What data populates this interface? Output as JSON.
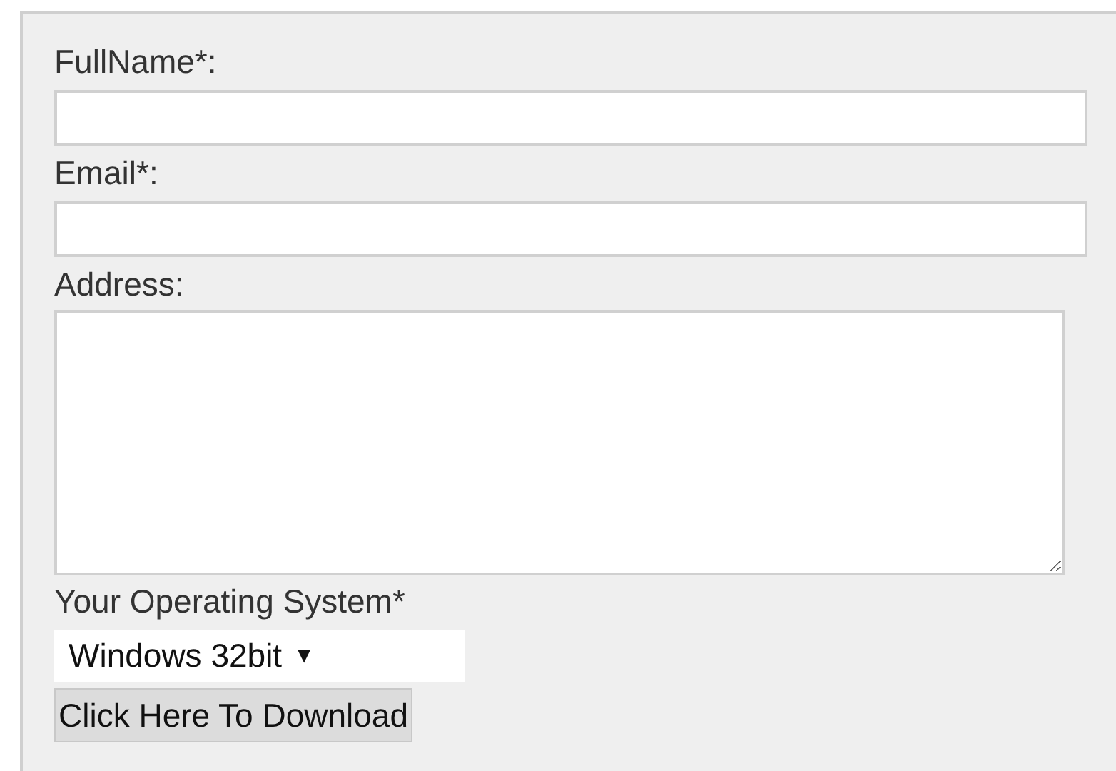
{
  "form": {
    "fields": [
      {
        "kind": "text",
        "label": "FullName*:"
      },
      {
        "kind": "text",
        "label": "Email*:"
      },
      {
        "kind": "textarea",
        "label": "Address:"
      },
      {
        "kind": "select",
        "label": "Your Operating System*",
        "value": "Windows 32bit",
        "caret": "▼"
      }
    ],
    "button": "Click Here To Download"
  }
}
